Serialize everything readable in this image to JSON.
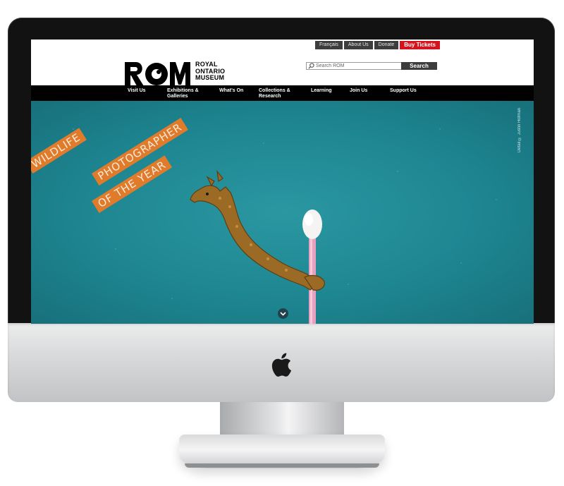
{
  "utility_nav": {
    "francais": "Français",
    "about": "About Us",
    "donate": "Donate",
    "buy": "Buy Tickets"
  },
  "logo": {
    "mark": "ROM",
    "line1": "ROYAL",
    "line2": "ONTARIO",
    "line3": "MUSEUM"
  },
  "search": {
    "placeholder": "Search ROM",
    "button": "Search"
  },
  "nav": {
    "visit": "Visit Us",
    "exhibitions_1": "Exhibitions &",
    "exhibitions_2": "Galleries",
    "whats_on": "What's On",
    "collections_1": "Collections &",
    "collections_2": "Research",
    "learning": "Learning",
    "join": "Join Us",
    "support": "Support Us"
  },
  "hero": {
    "word1": "WILDLIFE",
    "word2": "PHOTOGRAPHER",
    "word3": "OF THE YEAR",
    "credit": "Detail © Justin Hofman"
  },
  "colors": {
    "accent_red": "#d3141e",
    "banner_orange": "#e07b2c",
    "ocean": "#1e8691"
  }
}
